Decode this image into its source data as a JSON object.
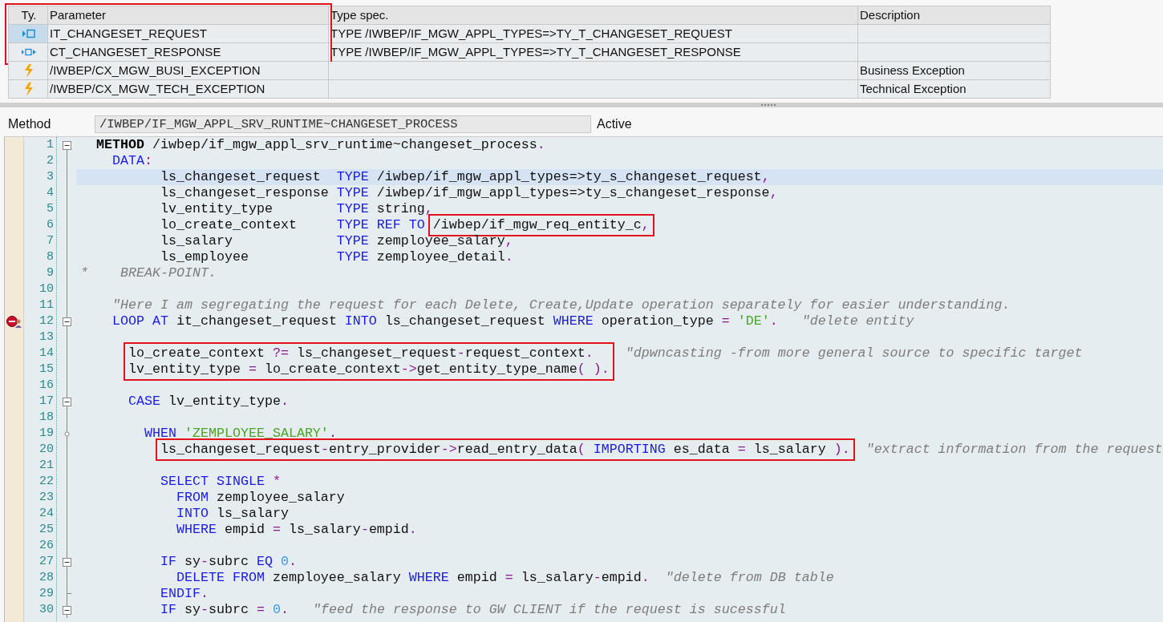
{
  "parameters": {
    "columns": [
      "Ty.",
      "Parameter",
      "Type spec.",
      "Description"
    ],
    "header_boxed": true,
    "rows": [
      {
        "kind": "importing",
        "selected": true,
        "boxed": true,
        "parameter": "IT_CHANGESET_REQUEST",
        "type_spec": "TYPE /IWBEP/IF_MGW_APPL_TYPES=>TY_T_CHANGESET_REQUEST"
      },
      {
        "kind": "changing",
        "selected": false,
        "boxed": true,
        "parameter": "CT_CHANGESET_RESPONSE",
        "type_spec": "TYPE /IWBEP/IF_MGW_APPL_TYPES=>TY_T_CHANGESET_RESPONSE"
      },
      {
        "kind": "exception",
        "selected": false,
        "boxed": false,
        "parameter": "/IWBEP/CX_MGW_BUSI_EXCEPTION",
        "description": "Business Exception"
      },
      {
        "kind": "exception",
        "selected": false,
        "boxed": false,
        "parameter": "/IWBEP/CX_MGW_TECH_EXCEPTION",
        "description": "Technical Exception"
      }
    ]
  },
  "method": {
    "label": "Method",
    "value": "/IWBEP/IF_MGW_APPL_SRV_RUNTIME~CHANGESET_PROCESS",
    "status": "Active"
  },
  "code": {
    "lines": [
      {
        "kind": "line",
        "number": "1",
        "collapsible": true,
        "tokens": [
          {
            "kind": "bold",
            "text": "  METHOD"
          },
          {
            "kind": "ident",
            "text": " /iwbep/if_mgw_appl_srv_runtime~changeset_process"
          },
          {
            "kind": "op",
            "text": "."
          }
        ]
      },
      {
        "kind": "line",
        "number": "2",
        "tokens": [
          {
            "kind": "keyword",
            "text": "    DATA"
          },
          {
            "kind": "op",
            "text": ":"
          }
        ]
      },
      {
        "kind": "line",
        "number": "3",
        "current": true,
        "tokens": [
          {
            "kind": "ident",
            "text": "          ls_changeset_request  "
          },
          {
            "kind": "keyword",
            "text": "TYPE"
          },
          {
            "kind": "ident",
            "text": " /iwbep/if_mgw_appl_types=>ty_s_changeset_request"
          },
          {
            "kind": "op",
            "text": ","
          }
        ]
      },
      {
        "kind": "line",
        "number": "4",
        "tokens": [
          {
            "kind": "ident",
            "text": "          ls_changeset_response "
          },
          {
            "kind": "keyword",
            "text": "TYPE"
          },
          {
            "kind": "ident",
            "text": " /iwbep/if_mgw_appl_types=>ty_s_changeset_response"
          },
          {
            "kind": "op",
            "text": ","
          }
        ]
      },
      {
        "kind": "line",
        "number": "5",
        "tokens": [
          {
            "kind": "ident",
            "text": "          lv_entity_type        "
          },
          {
            "kind": "keyword",
            "text": "TYPE"
          },
          {
            "kind": "ident",
            "text": " string"
          },
          {
            "kind": "op",
            "text": ","
          }
        ]
      },
      {
        "kind": "boxed_group",
        "lines": [
          {
            "number": "6",
            "before": [
              {
                "kind": "ident",
                "text": "          lo_create_context     "
              },
              {
                "kind": "keyword",
                "text": "TYPE"
              },
              {
                "kind": "keyword",
                "text": " REF"
              },
              {
                "kind": "keyword",
                "text": " TO"
              }
            ],
            "boxed": [
              {
                "kind": "ident",
                "text": " /iwbep/if_mgw_req_entity_c"
              },
              {
                "kind": "op",
                "text": ","
              }
            ]
          }
        ]
      },
      {
        "kind": "line",
        "number": "7",
        "tokens": [
          {
            "kind": "ident",
            "text": "          ls_salary             "
          },
          {
            "kind": "keyword",
            "text": "TYPE"
          },
          {
            "kind": "ident",
            "text": " zemployee_salary"
          },
          {
            "kind": "op",
            "text": ","
          }
        ]
      },
      {
        "kind": "line",
        "number": "8",
        "tokens": [
          {
            "kind": "ident",
            "text": "          ls_employee           "
          },
          {
            "kind": "keyword",
            "text": "TYPE"
          },
          {
            "kind": "ident",
            "text": " zemployee_detail"
          },
          {
            "kind": "op",
            "text": "."
          }
        ]
      },
      {
        "kind": "line",
        "number": "9",
        "tokens": [
          {
            "kind": "comment",
            "text": "*    BREAK-POINT."
          }
        ]
      },
      {
        "kind": "line",
        "number": "10"
      },
      {
        "kind": "line",
        "number": "11",
        "tokens": [
          {
            "kind": "comment",
            "text": "    \"Here I am segregating the request for each Delete, Create,Update operation separately for easier understanding."
          }
        ]
      },
      {
        "kind": "line",
        "number": "12",
        "collapsible": true,
        "breakpoint": true,
        "tokens": [
          {
            "kind": "keyword",
            "text": "    LOOP"
          },
          {
            "kind": "keyword",
            "text": " AT"
          },
          {
            "kind": "ident",
            "text": " it_changeset_request"
          },
          {
            "kind": "keyword",
            "text": " INTO"
          },
          {
            "kind": "ident",
            "text": " ls_changeset_request"
          },
          {
            "kind": "keyword",
            "text": " WHERE"
          },
          {
            "kind": "ident",
            "text": " operation_type"
          },
          {
            "kind": "op",
            "text": " ="
          },
          {
            "kind": "string",
            "text": " 'DE'"
          },
          {
            "kind": "op",
            "text": "."
          },
          {
            "kind": "comment",
            "text": "   \"delete entity"
          }
        ]
      },
      {
        "kind": "line",
        "number": "13"
      },
      {
        "kind": "boxed_group",
        "lines": [
          {
            "number": "14",
            "boxed": [
              {
                "kind": "ident",
                "text": "      lo_create_context"
              },
              {
                "kind": "op",
                "text": " ?="
              },
              {
                "kind": "ident",
                "text": " ls_changeset_request"
              },
              {
                "kind": "op",
                "text": "-"
              },
              {
                "kind": "ident",
                "text": "request_context"
              },
              {
                "kind": "op",
                "text": "."
              }
            ],
            "after": [
              {
                "kind": "comment",
                "text": "  \"dpwncasting -from more general source to specific target"
              }
            ]
          },
          {
            "number": "15",
            "boxed": [
              {
                "kind": "ident",
                "text": "      lv_entity_type"
              },
              {
                "kind": "op",
                "text": " ="
              },
              {
                "kind": "ident",
                "text": " lo_create_context"
              },
              {
                "kind": "op",
                "text": "->"
              },
              {
                "kind": "ident",
                "text": "get_entity_type_name"
              },
              {
                "kind": "op",
                "text": "("
              },
              {
                "kind": "op",
                "text": " )"
              },
              {
                "kind": "op",
                "text": "."
              }
            ]
          }
        ]
      },
      {
        "kind": "line",
        "number": "16"
      },
      {
        "kind": "line",
        "number": "17",
        "collapsible": true,
        "tokens": [
          {
            "kind": "keyword",
            "text": "      CASE"
          },
          {
            "kind": "ident",
            "text": " lv_entity_type"
          },
          {
            "kind": "op",
            "text": "."
          }
        ]
      },
      {
        "kind": "line",
        "number": "18"
      },
      {
        "kind": "line",
        "number": "19",
        "branch": true,
        "tokens": [
          {
            "kind": "keyword",
            "text": "        WHEN"
          },
          {
            "kind": "string",
            "text": " 'ZEMPLOYEE_SALARY'"
          },
          {
            "kind": "op",
            "text": "."
          }
        ]
      },
      {
        "kind": "boxed_group",
        "lines": [
          {
            "number": "20",
            "boxed": [
              {
                "kind": "ident",
                "text": "          ls_changeset_request"
              },
              {
                "kind": "op",
                "text": "-"
              },
              {
                "kind": "ident",
                "text": "entry_provider"
              },
              {
                "kind": "op",
                "text": "->"
              },
              {
                "kind": "ident",
                "text": "read_entry_data"
              },
              {
                "kind": "op",
                "text": "("
              },
              {
                "kind": "keyword",
                "text": " IMPORTING"
              },
              {
                "kind": "ident",
                "text": " es_data"
              },
              {
                "kind": "op",
                "text": " ="
              },
              {
                "kind": "ident",
                "text": " ls_salary"
              },
              {
                "kind": "op",
                "text": " )"
              },
              {
                "kind": "op",
                "text": "."
              }
            ],
            "after": [
              {
                "kind": "comment",
                "text": "  \"extract information from the request"
              }
            ]
          }
        ]
      },
      {
        "kind": "line",
        "number": "21"
      },
      {
        "kind": "line",
        "number": "22",
        "tokens": [
          {
            "kind": "keyword",
            "text": "          SELECT"
          },
          {
            "kind": "keyword",
            "text": " SINGLE"
          },
          {
            "kind": "op",
            "text": " *"
          }
        ]
      },
      {
        "kind": "line",
        "number": "23",
        "tokens": [
          {
            "kind": "keyword",
            "text": "            FROM"
          },
          {
            "kind": "ident",
            "text": " zemployee_salary"
          }
        ]
      },
      {
        "kind": "line",
        "number": "24",
        "tokens": [
          {
            "kind": "keyword",
            "text": "            INTO"
          },
          {
            "kind": "ident",
            "text": " ls_salary"
          }
        ]
      },
      {
        "kind": "line",
        "number": "25",
        "tokens": [
          {
            "kind": "keyword",
            "text": "            WHERE"
          },
          {
            "kind": "ident",
            "text": " empid"
          },
          {
            "kind": "op",
            "text": " ="
          },
          {
            "kind": "ident",
            "text": " ls_salary"
          },
          {
            "kind": "op",
            "text": "-"
          },
          {
            "kind": "ident",
            "text": "empid"
          },
          {
            "kind": "op",
            "text": "."
          }
        ]
      },
      {
        "kind": "line",
        "number": "26"
      },
      {
        "kind": "line",
        "number": "27",
        "collapsible": true,
        "tokens": [
          {
            "kind": "keyword",
            "text": "          IF"
          },
          {
            "kind": "ident",
            "text": " sy"
          },
          {
            "kind": "op",
            "text": "-"
          },
          {
            "kind": "ident",
            "text": "subrc"
          },
          {
            "kind": "keyword",
            "text": " EQ"
          },
          {
            "kind": "number",
            "text": " 0"
          },
          {
            "kind": "op",
            "text": "."
          }
        ]
      },
      {
        "kind": "line",
        "number": "28",
        "tokens": [
          {
            "kind": "keyword",
            "text": "            DELETE"
          },
          {
            "kind": "keyword",
            "text": " FROM"
          },
          {
            "kind": "ident",
            "text": " zemployee_salary"
          },
          {
            "kind": "keyword",
            "text": " WHERE"
          },
          {
            "kind": "ident",
            "text": " empid"
          },
          {
            "kind": "op",
            "text": " ="
          },
          {
            "kind": "ident",
            "text": " ls_salary"
          },
          {
            "kind": "op",
            "text": "-"
          },
          {
            "kind": "ident",
            "text": "empid"
          },
          {
            "kind": "op",
            "text": "."
          },
          {
            "kind": "comment",
            "text": "  \"delete from DB table"
          }
        ]
      },
      {
        "kind": "line",
        "number": "29",
        "block_end": true,
        "tokens": [
          {
            "kind": "keyword",
            "text": "          ENDIF"
          },
          {
            "kind": "op",
            "text": "."
          }
        ]
      },
      {
        "kind": "line",
        "number": "30",
        "collapsible": true,
        "tokens": [
          {
            "kind": "keyword",
            "text": "          IF"
          },
          {
            "kind": "ident",
            "text": " sy"
          },
          {
            "kind": "op",
            "text": "-"
          },
          {
            "kind": "ident",
            "text": "subrc"
          },
          {
            "kind": "op",
            "text": " ="
          },
          {
            "kind": "number",
            "text": " 0"
          },
          {
            "kind": "op",
            "text": "."
          },
          {
            "kind": "comment",
            "text": "   \"feed the response to GW CLIENT if the request is sucessful"
          }
        ]
      }
    ]
  }
}
